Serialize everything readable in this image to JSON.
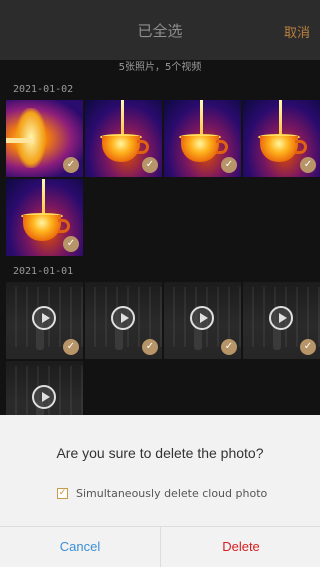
{
  "header": {
    "title": "已全选",
    "cancel_label": "取消"
  },
  "summary": "5张照片，5个视频",
  "groups": [
    {
      "date": "2021-01-02",
      "items": [
        "thermal",
        "thermal",
        "thermal",
        "thermal",
        "thermal"
      ]
    },
    {
      "date": "2021-01-01",
      "items": [
        "video",
        "video",
        "video",
        "video",
        "video"
      ]
    }
  ],
  "dialog": {
    "message": "Are you sure to delete the photo?",
    "option_label": "Simultaneously delete cloud photo",
    "option_checked": true,
    "cancel_label": "Cancel",
    "delete_label": "Delete"
  },
  "colors": {
    "accent": "#b8803e",
    "cancel_blue": "#3b8fd6",
    "delete_red": "#d71f1f"
  },
  "icons": {
    "selected_check": "check-icon",
    "video_play": "play-icon"
  }
}
